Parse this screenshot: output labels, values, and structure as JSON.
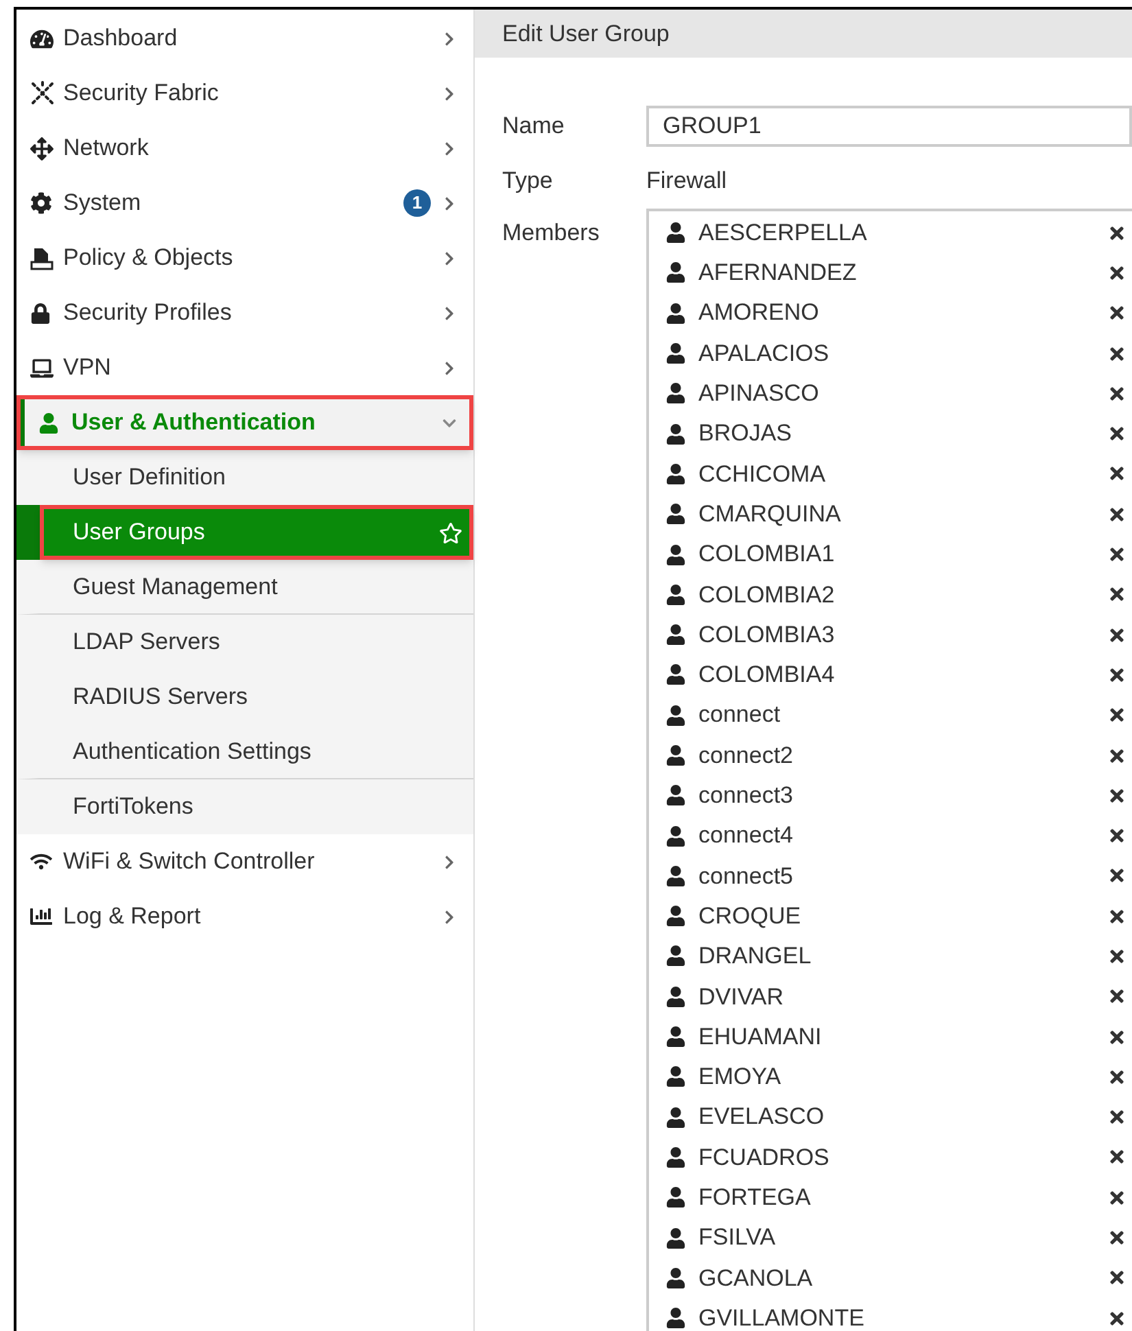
{
  "sidebar": {
    "items": [
      {
        "label": "Dashboard",
        "expanded": false
      },
      {
        "label": "Security Fabric",
        "expanded": false
      },
      {
        "label": "Network",
        "expanded": false
      },
      {
        "label": "System",
        "expanded": false,
        "badge": "1"
      },
      {
        "label": "Policy & Objects",
        "expanded": false
      },
      {
        "label": "Security Profiles",
        "expanded": false
      },
      {
        "label": "VPN",
        "expanded": false
      },
      {
        "label": "User & Authentication",
        "expanded": true,
        "annotated": true,
        "children": [
          {
            "label": "User Definition",
            "selected": false,
            "annotated": false,
            "divider_after": false
          },
          {
            "label": "User Groups",
            "selected": true,
            "annotated": true,
            "divider_after": false
          },
          {
            "label": "Guest Management",
            "selected": false,
            "annotated": false,
            "divider_after": true
          },
          {
            "label": "LDAP Servers",
            "selected": false,
            "annotated": false,
            "divider_after": false
          },
          {
            "label": "RADIUS Servers",
            "selected": false,
            "annotated": false,
            "divider_after": false
          },
          {
            "label": "Authentication Settings",
            "selected": false,
            "annotated": false,
            "divider_after": true
          },
          {
            "label": "FortiTokens",
            "selected": false,
            "annotated": false,
            "divider_after": false
          }
        ]
      },
      {
        "label": "WiFi & Switch Controller",
        "expanded": false
      },
      {
        "label": "Log & Report",
        "expanded": false
      }
    ]
  },
  "panel": {
    "title": "Edit User Group",
    "fields": [
      {
        "label": "Name",
        "kind": "input",
        "value": "GROUP1"
      },
      {
        "label": "Type",
        "kind": "text",
        "value": "Firewall"
      }
    ],
    "members_label": "Members",
    "members": [
      "AESCERPELLA",
      "AFERNANDEZ",
      "AMORENO",
      "APALACIOS",
      "APINASCO",
      "BROJAS",
      "CCHICOMA",
      "CMARQUINA",
      "COLOMBIA1",
      "COLOMBIA2",
      "COLOMBIA3",
      "COLOMBIA4",
      "connect",
      "connect2",
      "connect3",
      "connect4",
      "connect5",
      "CROQUE",
      "DRANGEL",
      "DVIVAR",
      "EHUAMANI",
      "EMOYA",
      "EVELASCO",
      "FCUADROS",
      "FORTEGA",
      "FSILVA",
      "GCANOLA",
      "GVILLAMONTE"
    ]
  }
}
